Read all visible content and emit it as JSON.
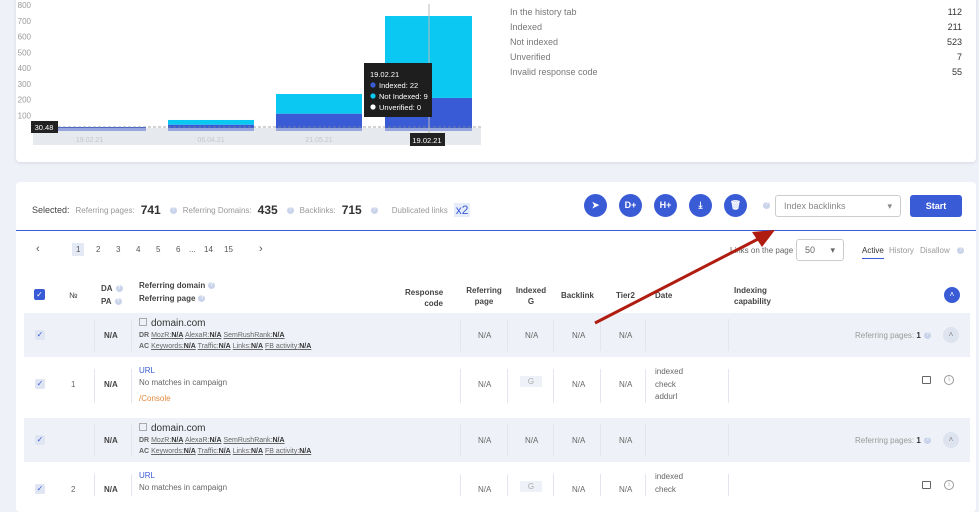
{
  "chart_data": {
    "type": "bar",
    "stacked": true,
    "categories": [
      "19.02.21",
      "06.04.21",
      "21.05.21",
      "19.02.21"
    ],
    "series": [
      {
        "name": "Indexed",
        "color": "#3a5bd6",
        "values": [
          25,
          40,
          110,
          210
        ]
      },
      {
        "name": "Not Indexed",
        "color": "#0bc8f2",
        "values": [
          0,
          30,
          125,
          520
        ]
      }
    ],
    "ylim": [
      0,
      800
    ],
    "yticks": [
      100,
      200,
      300,
      400,
      500,
      600,
      700,
      800
    ],
    "crosshair_label": "30.48",
    "hover_x_label": "19.02.21",
    "tooltip": {
      "title": "19.02.21",
      "items": [
        "Indexed: 22",
        "Not Indexed: 9",
        "Unverified: 0"
      ],
      "colors": [
        "#3a5bd6",
        "#0bc8f2",
        "#ffffff"
      ]
    }
  },
  "stats": [
    {
      "label": "In the history tab",
      "value": "112"
    },
    {
      "label": "Indexed",
      "value": "211"
    },
    {
      "label": "Not indexed",
      "value": "523"
    },
    {
      "label": "Unverified",
      "value": "7"
    },
    {
      "label": "Invalid response code",
      "value": "55"
    }
  ],
  "selected": {
    "label": "Selected:",
    "ref_pages_label": "Referring pages:",
    "ref_pages": "741",
    "ref_domains_label": "Referring Domains:",
    "ref_domains": "435",
    "backlinks_label": "Backlinks:",
    "backlinks": "715",
    "dup_label": "Dublicated links",
    "dup": "x2"
  },
  "actions": {
    "buttons": [
      "D+",
      "H+"
    ],
    "select": "Index backlinks",
    "start": "Start"
  },
  "pagination": {
    "prev": "‹",
    "next": "›",
    "pages": [
      "1",
      "2",
      "3",
      "4",
      "5",
      "6",
      "...",
      "14",
      "15"
    ]
  },
  "links_on_page": {
    "label": "Links on the page",
    "value": "50"
  },
  "view_tabs": [
    "Active",
    "History",
    "Disallow"
  ],
  "headers": {
    "num": "№",
    "da": "DA",
    "pa": "PA",
    "ref_domain": "Referring domain",
    "ref_page": "Referring page",
    "response": "Response code",
    "refpage": "Referring page",
    "indexed": "Indexed G",
    "backlink": "Backlink",
    "tier2": "Tier2",
    "date": "Date",
    "indexing": "Indexing capability"
  },
  "domain_row": {
    "domain": "domain.com",
    "da": "N/A",
    "dr": "DR",
    "ac": "AC",
    "moz": "MozR:",
    "alexa": "AlexaR:",
    "sem": "SemRushRank:",
    "kw": "Keywords:",
    "traffic": "Traffic:",
    "links": "Links:",
    "fb": "FB activity:",
    "na": "N/A",
    "ref_pages": "Referring pages:",
    "ref_count": "1"
  },
  "url_rows": [
    {
      "num": "1",
      "url": "URL",
      "note": "No matches in campaign",
      "console": "/Console",
      "g": "G",
      "dates": [
        "indexed",
        "check",
        "addurl"
      ]
    },
    {
      "num": "2",
      "url": "URL",
      "note": "No matches in campaign",
      "g": "G",
      "dates": [
        "indexed",
        "check"
      ]
    }
  ]
}
